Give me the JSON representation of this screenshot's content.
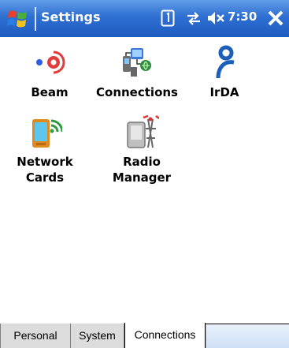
{
  "titlebar": {
    "title": "Settings",
    "clock": "7:30",
    "icons": {
      "start": "windows-start-icon",
      "sim": "sim-card-icon",
      "connectivity": "connectivity-arrows-icon",
      "volume": "volume-muted-icon",
      "close": "close-icon"
    }
  },
  "items": [
    {
      "label": "Beam",
      "icon": "beam-icon"
    },
    {
      "label": "Connections",
      "icon": "connections-icon"
    },
    {
      "label": "IrDA",
      "icon": "irda-icon"
    },
    {
      "label": "Network\nCards",
      "label_line1": "Network",
      "label_line2": "Cards",
      "icon": "network-cards-icon"
    },
    {
      "label": "Radio\nManager",
      "label_line1": "Radio",
      "label_line2": "Manager",
      "icon": "radio-manager-icon"
    }
  ],
  "tabs": [
    {
      "label": "Personal",
      "active": false
    },
    {
      "label": "System",
      "active": false
    },
    {
      "label": "Connections",
      "active": true
    }
  ],
  "colors": {
    "titlebar": "#2e6fd2",
    "tab_inactive": "#dcdcdc",
    "tab_active": "#ffffff"
  }
}
